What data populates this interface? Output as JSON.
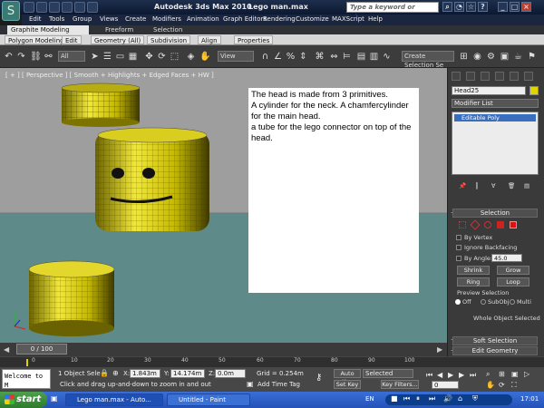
{
  "title": {
    "app": "Autodesk 3ds Max  2010",
    "file": "Lego man.max",
    "search_placeholder": "Type a keyword or phrase"
  },
  "menu": [
    "Edit",
    "Tools",
    "Group",
    "Views",
    "Create",
    "Modifiers",
    "Animation",
    "Graph Editors",
    "Rendering",
    "Customize",
    "MAXScript",
    "Help"
  ],
  "ribbon_tabs": [
    "Graphite Modeling Tools",
    "Freeform",
    "Selection"
  ],
  "ribbon_items": [
    "Polygon Modeling",
    "Edit",
    "Geometry (All)",
    "Subdivision",
    "Align",
    "Properties"
  ],
  "toolbar": {
    "filter": "All",
    "view": "View",
    "selection_set": "Create Selection Se"
  },
  "viewport": {
    "label": "[ + ] [ Perspective ] [ Smooth + Highlights + Edged Faces + HW ]"
  },
  "note": "The head is made from 3 primitives.\nA cylinder for the neck.  A chamfercylinder for the main head.\na tube for the lego connector on top of the head.",
  "cmd": {
    "object_name": "Head25",
    "modifier_list": "Modifier List",
    "stack_item": "Editable Poly",
    "selection_header": "Selection",
    "by_vertex": "By Vertex",
    "ignore_backfacing": "Ignore Backfacing",
    "by_angle": "By Angle:",
    "angle_value": "45.0",
    "shrink": "Shrink",
    "grow": "Grow",
    "ring": "Ring",
    "loop": "Loop",
    "preview_selection": "Preview Selection",
    "off": "Off",
    "subobj": "SubObj",
    "multi": "Multi",
    "status": "Whole Object Selected",
    "soft_selection": "Soft Selection",
    "edit_geometry": "Edit Geometry",
    "plus": "+"
  },
  "timeline": {
    "frame": "0 / 100",
    "ticks": [
      "0",
      "10",
      "20",
      "30",
      "40",
      "50",
      "60",
      "70",
      "80",
      "90",
      "100"
    ]
  },
  "status": {
    "selected": "1 Object Sele",
    "x": "1.843m",
    "y": "14.174m",
    "z": "0.0m",
    "grid": "Grid = 0.254m",
    "auto_key": "Auto Key",
    "set_key": "Set Key",
    "key_mode": "Selected",
    "key_filters": "Key Filters...",
    "frame_field": "0",
    "prompt": "Click and drag up-and-down to zoom in and out",
    "add_time_tag": "Add Time Tag",
    "listener": "Welcome to M"
  },
  "taskbar": {
    "start": "start",
    "task1": "Lego man.max - Auto...",
    "task2": "Untitled - Paint",
    "lang": "EN",
    "time": "17:01"
  }
}
